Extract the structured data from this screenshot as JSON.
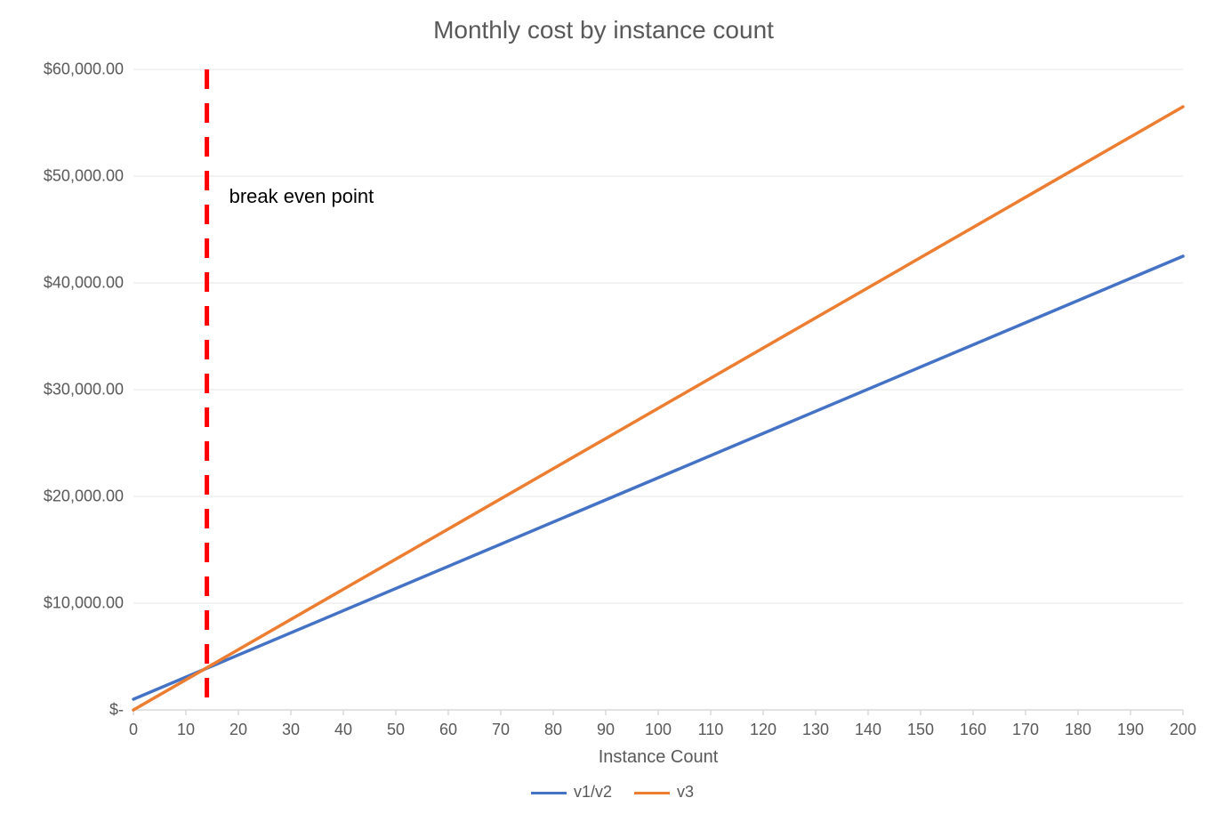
{
  "chart_data": {
    "type": "line",
    "title": "Monthly cost by instance count",
    "xlabel": "Instance Count",
    "ylabel": "",
    "xlim": [
      0,
      200
    ],
    "ylim": [
      0,
      60000
    ],
    "x_ticks": [
      0,
      10,
      20,
      30,
      40,
      50,
      60,
      70,
      80,
      90,
      100,
      110,
      120,
      130,
      140,
      150,
      160,
      170,
      180,
      190,
      200
    ],
    "y_ticks": [
      0,
      10000,
      20000,
      30000,
      40000,
      50000,
      60000
    ],
    "y_tick_labels": [
      "$-",
      "$10,000.00",
      "$20,000.00",
      "$30,000.00",
      "$40,000.00",
      "$50,000.00",
      "$60,000.00"
    ],
    "series": [
      {
        "name": "v1/v2",
        "color": "#4472C4",
        "x": [
          0,
          200
        ],
        "y": [
          1000,
          42500
        ]
      },
      {
        "name": "v3",
        "color": "#ED7D31",
        "x": [
          0,
          200
        ],
        "y": [
          0,
          56500
        ]
      }
    ],
    "annotations": [
      {
        "type": "vline",
        "x": 14,
        "color": "#FF0000",
        "style": "dashed",
        "label": "break even point"
      }
    ],
    "grid": "horizontal"
  },
  "colors": {
    "grid": "#E6E6E6",
    "axis": "#D9D9D9",
    "text": "#595959",
    "bg": "#ffffff"
  }
}
